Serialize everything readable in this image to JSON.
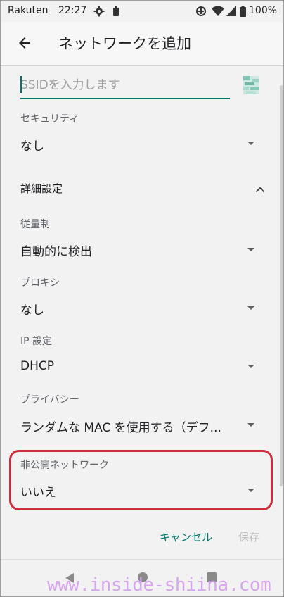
{
  "status_bar": {
    "carrier": "Rakuten",
    "time": "22:27",
    "battery": "100%"
  },
  "app_bar": {
    "title": "ネットワークを追加",
    "back_icon": "arrow-left-icon"
  },
  "ssid": {
    "placeholder": "SSIDを入力します",
    "value": ""
  },
  "fields": {
    "security": {
      "label": "セキュリティ",
      "value": "なし"
    },
    "advanced": {
      "label": "詳細設定",
      "expanded": true
    },
    "metered": {
      "label": "従量制",
      "value": "自動的に検出"
    },
    "proxy": {
      "label": "プロキシ",
      "value": "なし"
    },
    "ip": {
      "label": "IP 設定",
      "value": "DHCP"
    },
    "privacy": {
      "label": "プライバシー",
      "value": "ランダムな MAC を使用する（デフ..."
    },
    "hidden": {
      "label": "非公開ネットワーク",
      "value": "いいえ"
    }
  },
  "actions": {
    "cancel": "キャンセル",
    "save": "保存"
  },
  "watermark": "www.inside-shiina.com",
  "colors": {
    "accent": "#00796b",
    "highlight": "#d02b3b",
    "disabled": "#bdbdbd",
    "watermark": "#d6a0f0"
  }
}
